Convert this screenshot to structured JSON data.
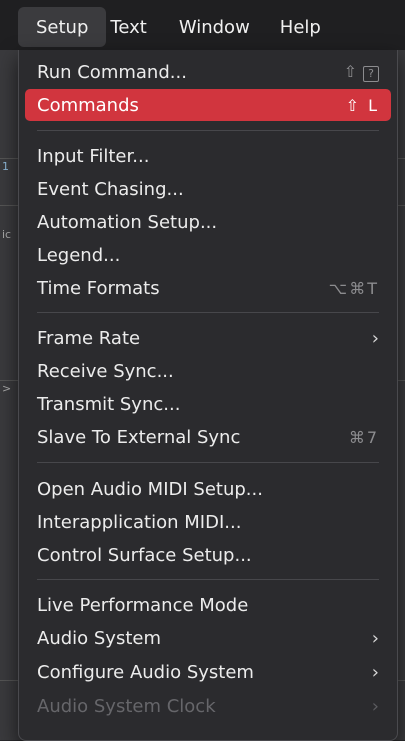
{
  "menubar": {
    "items": [
      "Setup",
      "Text",
      "Window",
      "Help"
    ],
    "active": "Setup"
  },
  "background_fragments": [
    "1",
    "ic",
    ">"
  ],
  "menu": {
    "groups": [
      [
        {
          "label": "Run Command...",
          "shortcut": "⇧",
          "shortcut_extra": "?"
        },
        {
          "label": "Commands",
          "shortcut": "⇧ L",
          "highlighted": true
        }
      ],
      [
        {
          "label": "Input Filter..."
        },
        {
          "label": "Event Chasing..."
        },
        {
          "label": "Automation Setup..."
        },
        {
          "label": "Legend..."
        },
        {
          "label": "Time Formats",
          "shortcut": "⌥⌘T"
        }
      ],
      [
        {
          "label": "Frame Rate",
          "submenu": true
        },
        {
          "label": "Receive Sync..."
        },
        {
          "label": "Transmit Sync..."
        },
        {
          "label": "Slave To External Sync",
          "shortcut": "⌘7"
        }
      ],
      [
        {
          "label": "Open Audio MIDI Setup..."
        },
        {
          "label": "Interapplication MIDI..."
        },
        {
          "label": "Control Surface Setup..."
        }
      ],
      [
        {
          "label": "Live Performance Mode"
        },
        {
          "label": "Audio System",
          "submenu": true
        },
        {
          "label": "Configure Audio System",
          "submenu": true
        },
        {
          "label": "Audio System Clock",
          "submenu": true,
          "disabled": true
        }
      ]
    ],
    "submenu_glyph": "›"
  }
}
